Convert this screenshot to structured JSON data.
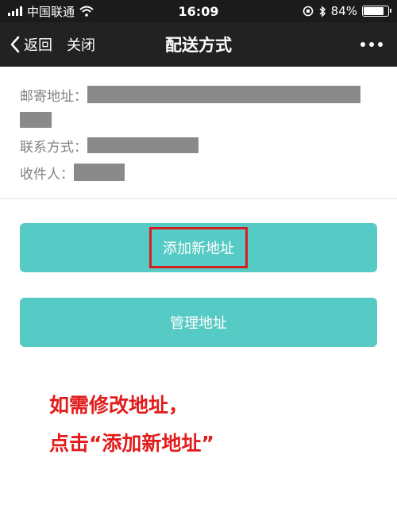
{
  "status_bar": {
    "carrier": "中国联通",
    "time": "16:09",
    "battery_percent": "84%",
    "battery_level": 0.84
  },
  "nav": {
    "back_label": "返回",
    "close_label": "关闭",
    "title": "配送方式"
  },
  "address_info": {
    "postal_label": "邮寄地址：",
    "contact_label": "联系方式：",
    "recipient_label": "收件人："
  },
  "buttons": {
    "add_address": "添加新地址",
    "manage_address": "管理地址"
  },
  "hint": {
    "line1": "如需修改地址，",
    "line2": "点击“添加新地址”"
  },
  "colors": {
    "button_bg": "#56cac4",
    "highlight_border": "#d42020",
    "hint_text": "#e21b1b"
  }
}
